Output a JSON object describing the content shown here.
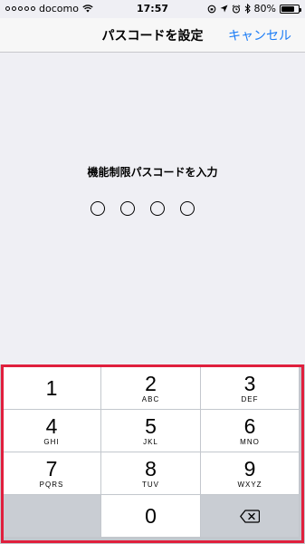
{
  "status_bar": {
    "carrier": "docomo",
    "time": "17:57",
    "battery": "80%",
    "battery_level": 0.8,
    "signal_dots_filled": 0
  },
  "navbar": {
    "title": "パスコードを設定",
    "cancel_label": "キャンセル"
  },
  "main": {
    "prompt": "機能制限パスコードを入力",
    "passcode_length": 4
  },
  "keypad": {
    "keys": [
      {
        "digit": "1",
        "letters": ""
      },
      {
        "digit": "2",
        "letters": "ABC"
      },
      {
        "digit": "3",
        "letters": "DEF"
      },
      {
        "digit": "4",
        "letters": "GHI"
      },
      {
        "digit": "5",
        "letters": "JKL"
      },
      {
        "digit": "6",
        "letters": "MNO"
      },
      {
        "digit": "7",
        "letters": "PQRS"
      },
      {
        "digit": "8",
        "letters": "TUV"
      },
      {
        "digit": "9",
        "letters": "WXYZ"
      },
      {
        "digit": "0",
        "letters": ""
      }
    ],
    "delete_icon": "backspace-icon"
  },
  "colors": {
    "accent": "#1b7cf6",
    "highlight_border": "#e01f3d",
    "background": "#efeff4"
  }
}
